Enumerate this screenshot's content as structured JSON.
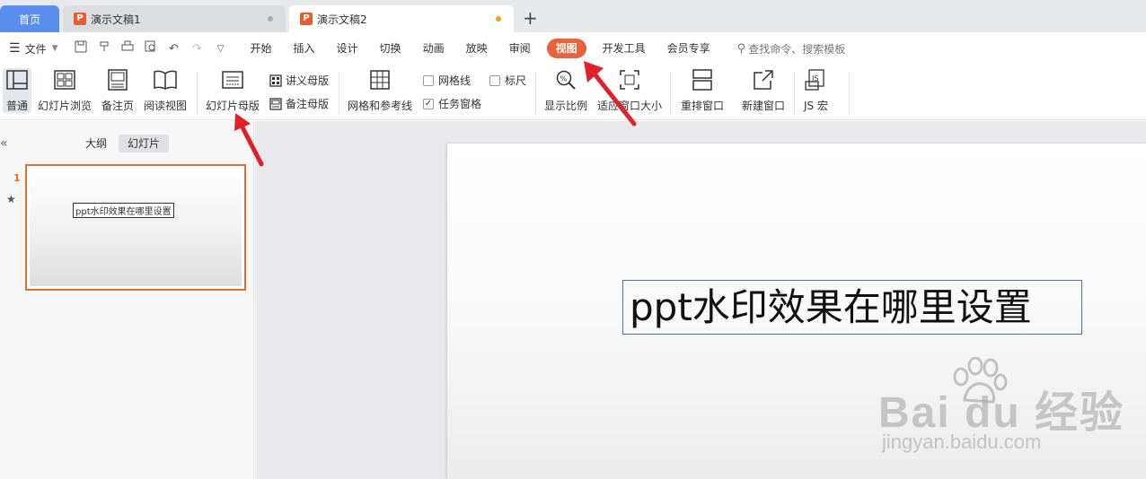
{
  "tabs": {
    "home": "首页",
    "doc1": "演示文稿1",
    "doc2": "演示文稿2",
    "add": "+"
  },
  "menubar": {
    "file": "文件",
    "ribbon_tabs": [
      "开始",
      "插入",
      "设计",
      "切换",
      "动画",
      "放映",
      "审阅",
      "视图",
      "开发工具",
      "会员专享"
    ],
    "active_tab": "视图",
    "search": "查找命令、搜索模板"
  },
  "toolbar": {
    "normal": "普通",
    "slide_browse": "幻灯片浏览",
    "notes_page": "备注页",
    "reading_view": "阅读视图",
    "slide_master": "幻灯片母版",
    "handout_master": "讲义母版",
    "notes_master": "备注母版",
    "grid_guides": "网格和参考线",
    "gridlines": "网格线",
    "ruler": "标尺",
    "task_pane": "任务窗格",
    "zoom": "显示比例",
    "fit_window": "适应窗口大小",
    "arrange": "重排窗口",
    "new_window": "新建窗口",
    "macro": "JS 宏"
  },
  "panel": {
    "outline_tab": "大纲",
    "slides_tab": "幻灯片",
    "slide_number": "1",
    "thumb_title": "ppt水印效果在哪里设置"
  },
  "slide": {
    "title": "ppt水印效果在哪里设置"
  },
  "watermark": {
    "brand": "Bai du 经验",
    "url": "jingyan.baidu.com"
  },
  "colors": {
    "accent": "#e8623a",
    "home_tab": "#5b8def",
    "arrow": "#e0202a"
  }
}
